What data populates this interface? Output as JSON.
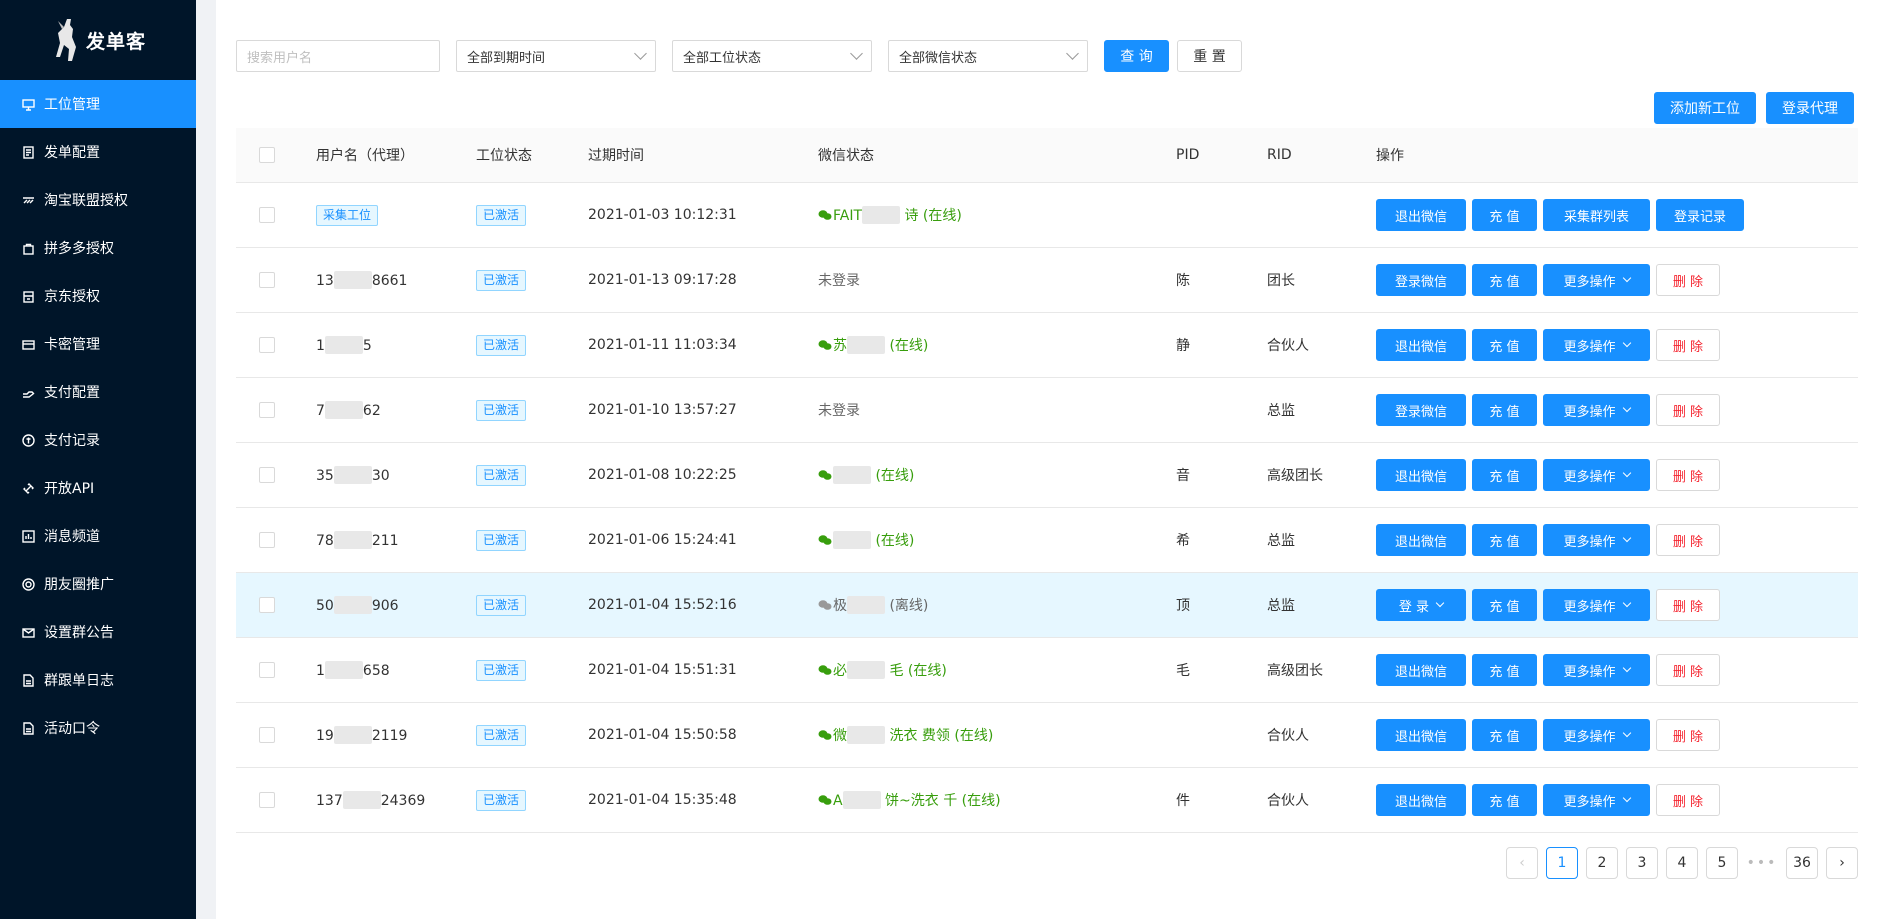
{
  "app": {
    "name": "发单客"
  },
  "sidebar": {
    "items": [
      {
        "label": "工位管理",
        "icon": "monitor-icon",
        "active": true
      },
      {
        "label": "发单配置",
        "icon": "document-icon"
      },
      {
        "label": "淘宝联盟授权",
        "icon": "link-icon"
      },
      {
        "label": "拼多多授权",
        "icon": "bag-icon"
      },
      {
        "label": "京东授权",
        "icon": "store-icon"
      },
      {
        "label": "卡密管理",
        "icon": "card-icon"
      },
      {
        "label": "支付配置",
        "icon": "hand-icon"
      },
      {
        "label": "支付记录",
        "icon": "coin-icon"
      },
      {
        "label": "开放API",
        "icon": "api-icon"
      },
      {
        "label": "消息频道",
        "icon": "chart-icon"
      },
      {
        "label": "朋友圈推广",
        "icon": "target-icon"
      },
      {
        "label": "设置群公告",
        "icon": "mail-icon"
      },
      {
        "label": "群跟单日志",
        "icon": "file-icon"
      },
      {
        "label": "活动口令",
        "icon": "file-icon"
      }
    ]
  },
  "filters": {
    "search_placeholder": "搜索用户名",
    "expire_select": "全部到期时间",
    "station_select": "全部工位状态",
    "wechat_select": "全部微信状态",
    "query_label": "查 询",
    "reset_label": "重 置"
  },
  "actions": {
    "add_station": "添加新工位",
    "login_proxy": "登录代理"
  },
  "table": {
    "headers": [
      "用户名（代理）",
      "工位状态",
      "过期时间",
      "微信状态",
      "PID",
      "RID",
      "操作"
    ],
    "rows": [
      {
        "user": "采集工位",
        "user_is_tag": true,
        "status": "已激活",
        "time": "2021-01-03 10:12:31",
        "wx": "FAIT",
        "wx_tail": "诗 (在线)",
        "wx_online": true,
        "pid": "",
        "rid": "",
        "ops": [
          "退出微信",
          "充 值",
          "采集群列表",
          "登录记录"
        ]
      },
      {
        "user": "13",
        "user_tail": "8661",
        "status": "已激活",
        "time": "2021-01-13 09:17:28",
        "wx": "未登录",
        "wx_tail": "",
        "wx_online": null,
        "pid": "陈",
        "rid": "团长",
        "ops": [
          "登录微信",
          "充 值",
          "更多操作",
          "删 除"
        ]
      },
      {
        "user": "1",
        "user_tail": "5",
        "status": "已激活",
        "time": "2021-01-11 11:03:34",
        "wx": "苏",
        "wx_tail": "(在线)",
        "wx_online": true,
        "pid": "静",
        "rid": "合伙人",
        "ops": [
          "退出微信",
          "充 值",
          "更多操作",
          "删 除"
        ]
      },
      {
        "user": "7",
        "user_tail": "62",
        "status": "已激活",
        "time": "2021-01-10 13:57:27",
        "wx": "未登录",
        "wx_tail": "",
        "wx_online": null,
        "pid": "",
        "rid": "总监",
        "ops": [
          "登录微信",
          "充 值",
          "更多操作",
          "删 除"
        ]
      },
      {
        "user": "35",
        "user_tail": "30",
        "status": "已激活",
        "time": "2021-01-08 10:22:25",
        "wx": "",
        "wx_tail": "(在线)",
        "wx_online": true,
        "pid": "音",
        "rid": "高级团长",
        "ops": [
          "退出微信",
          "充 值",
          "更多操作",
          "删 除"
        ]
      },
      {
        "user": "78",
        "user_tail": "211",
        "status": "已激活",
        "time": "2021-01-06 15:24:41",
        "wx": "",
        "wx_tail": "(在线)",
        "wx_online": true,
        "pid": "希",
        "rid": "总监",
        "ops": [
          "退出微信",
          "充 值",
          "更多操作",
          "删 除"
        ]
      },
      {
        "user": "50",
        "user_tail": "906",
        "status": "已激活",
        "time": "2021-01-04 15:52:16",
        "wx": "极",
        "wx_tail": "(离线)",
        "wx_online": false,
        "pid": "顶",
        "rid": "总监",
        "ops": [
          "登 录",
          "充 值",
          "更多操作",
          "删 除"
        ],
        "highlight": true
      },
      {
        "user": "1",
        "user_tail": "658",
        "status": "已激活",
        "time": "2021-01-04 15:51:31",
        "wx": "必",
        "wx_tail": "毛 (在线)",
        "wx_online": true,
        "pid": "毛",
        "rid": "高级团长",
        "ops": [
          "退出微信",
          "充 值",
          "更多操作",
          "删 除"
        ]
      },
      {
        "user": "19",
        "user_tail": "2119",
        "status": "已激活",
        "time": "2021-01-04 15:50:58",
        "wx": "微",
        "wx_tail": "洗衣 费领 (在线)",
        "wx_online": true,
        "pid": "",
        "rid": "合伙人",
        "ops": [
          "退出微信",
          "充 值",
          "更多操作",
          "删 除"
        ]
      },
      {
        "user": "137",
        "user_tail": "24369",
        "status": "已激活",
        "time": "2021-01-04 15:35:48",
        "wx": "A",
        "wx_tail": "饼~洗衣 千 (在线)",
        "wx_online": true,
        "pid": "件",
        "rid": "合伙人",
        "ops": [
          "退出微信",
          "充 值",
          "更多操作",
          "删 除"
        ]
      }
    ]
  },
  "pagination": {
    "pages": [
      "1",
      "2",
      "3",
      "4",
      "5"
    ],
    "last": "36",
    "current": "1",
    "ellipsis": "•••"
  },
  "colors": {
    "primary": "#1890ff",
    "sidebar": "#001529",
    "online": "#389e0d",
    "danger": "#f5222d"
  }
}
